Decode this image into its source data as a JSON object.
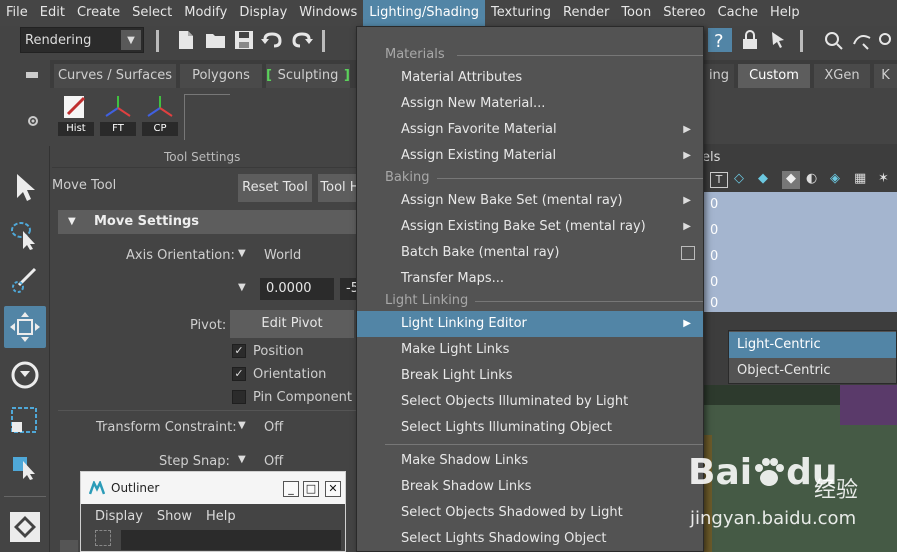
{
  "menubar": {
    "items": [
      "File",
      "Edit",
      "Create",
      "Select",
      "Modify",
      "Display",
      "Windows",
      "Lighting/Shading",
      "Texturing",
      "Render",
      "Toon",
      "Stereo",
      "Cache",
      "Help"
    ],
    "active_index": 7
  },
  "statusline": {
    "mode": "Rendering"
  },
  "shelf": {
    "tabs": [
      "Curves / Surfaces",
      "Polygons",
      "Sculpting",
      "ing",
      "Custom",
      "XGen",
      "K"
    ],
    "active_tab": "Custom",
    "buttons": [
      "Hist",
      "FT",
      "CP"
    ]
  },
  "tool_settings": {
    "header": "Tool Settings",
    "tool_name": "Move Tool",
    "reset_button": "Reset Tool",
    "tool_help_button": "Tool H",
    "section": "Move Settings",
    "axis_orientation_label": "Axis Orientation:",
    "axis_orientation_value": "World",
    "numeric_value": "0.0000",
    "numeric_value_2": "-5",
    "pivot_label": "Pivot:",
    "edit_pivot_button": "Edit Pivot",
    "position_label": "Position",
    "orientation_label": "Orientation",
    "pin_label": "Pin Component Pi",
    "transform_constraint_label": "Transform Constraint:",
    "transform_constraint_value": "Off",
    "step_snap_label": "Step Snap:",
    "step_snap_value": "Off"
  },
  "outliner": {
    "title": "Outliner",
    "menu": [
      "Display",
      "Show",
      "Help"
    ]
  },
  "channel_box": {
    "header_text": "els",
    "values": [
      "0",
      "0",
      "0",
      "0",
      "0"
    ]
  },
  "dropdown": {
    "sections": {
      "materials": "Materials",
      "baking": "Baking",
      "light_linking": "Light Linking"
    },
    "materials_items": [
      {
        "label": "Material Attributes",
        "submenu": false
      },
      {
        "label": "Assign New Material...",
        "submenu": false
      },
      {
        "label": "Assign Favorite Material",
        "submenu": true
      },
      {
        "label": "Assign Existing Material",
        "submenu": true
      }
    ],
    "baking_items": [
      {
        "label": "Assign New Bake Set (mental ray)",
        "submenu": true
      },
      {
        "label": "Assign Existing Bake Set (mental ray)",
        "submenu": true
      },
      {
        "label": "Batch Bake (mental ray)",
        "option_box": true
      },
      {
        "label": "Transfer Maps...",
        "submenu": false
      }
    ],
    "light_linking_items": [
      {
        "label": "Light Linking Editor",
        "submenu": true,
        "highlighted": true
      },
      {
        "label": "Make Light Links"
      },
      {
        "label": "Break Light Links"
      },
      {
        "label": "Select Objects Illuminated by Light"
      },
      {
        "label": "Select Lights Illuminating Object"
      }
    ],
    "shadow_items": [
      {
        "label": "Make Shadow Links"
      },
      {
        "label": "Break Shadow Links"
      },
      {
        "label": "Select Objects Shadowed by Light"
      },
      {
        "label": "Select Lights Shadowing Object"
      }
    ]
  },
  "submenu": {
    "items": [
      "Light-Centric",
      "Object-Centric"
    ],
    "highlighted_index": 0
  },
  "watermark": {
    "brand": "Bai",
    "brand_tail": "du",
    "chinese": "经验",
    "url": "jingyan.baidu.com"
  },
  "colors": {
    "highlight": "#5285a6",
    "menu_bg": "#535353",
    "window_bg": "#444444",
    "channel_row": "#a4b5cf",
    "sculpt_bracket": "#5bd15b"
  }
}
